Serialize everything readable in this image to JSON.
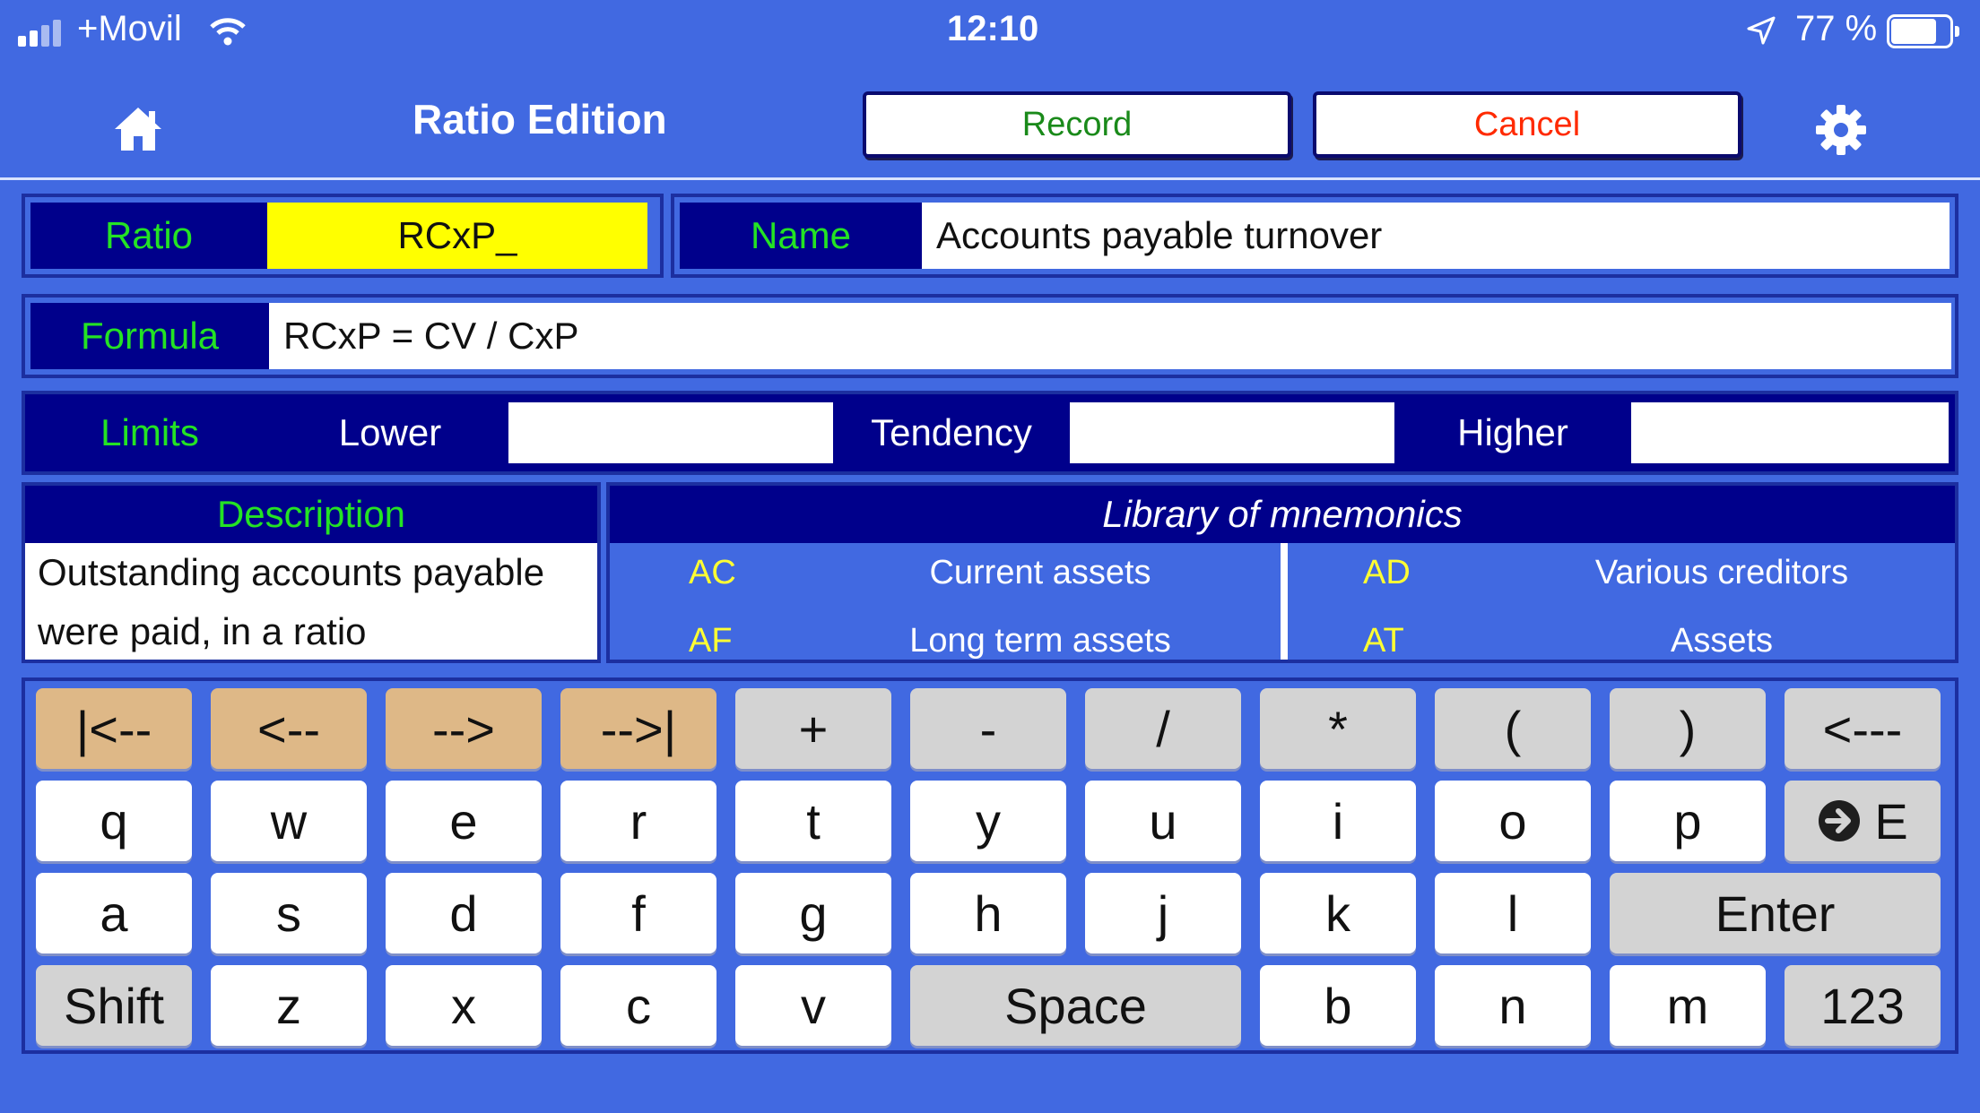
{
  "status_bar": {
    "carrier": "+Movil",
    "time": "12:10",
    "battery": "77 %",
    "battery_level": 0.77
  },
  "header": {
    "title": "Ratio Edition",
    "record_label": "Record",
    "cancel_label": "Cancel"
  },
  "form": {
    "ratio_label": "Ratio",
    "ratio_value": "RCxP_",
    "name_label": "Name",
    "name_value": "Accounts payable turnover",
    "formula_label": "Formula",
    "formula_value": "RCxP = CV / CxP",
    "limits_label": "Limits",
    "lower_label": "Lower",
    "lower_value": "",
    "tendency_label": "Tendency",
    "tendency_value": "",
    "higher_label": "Higher",
    "higher_value": "",
    "description_label": "Description",
    "description_value": "Outstanding accounts payable were paid, in a ratio"
  },
  "library": {
    "title": "Library of mnemonics",
    "items": [
      {
        "code": "AC",
        "desc": "Current assets"
      },
      {
        "code": "AD",
        "desc": "Various creditors"
      },
      {
        "code": "AF",
        "desc": "Long term assets"
      },
      {
        "code": "AT",
        "desc": "Assets"
      }
    ]
  },
  "keyboard": {
    "row1": [
      "|<--",
      "<--",
      "-->",
      "-->|",
      "+",
      "-",
      "/",
      "*",
      "(",
      ")",
      "<---"
    ],
    "row2": [
      "q",
      "w",
      "e",
      "r",
      "t",
      "y",
      "u",
      "i",
      "o",
      "p",
      "E"
    ],
    "row3": [
      "a",
      "s",
      "d",
      "f",
      "g",
      "h",
      "j",
      "k",
      "l",
      "Enter"
    ],
    "row4": [
      "Shift",
      "z",
      "x",
      "c",
      "v",
      "Space",
      "b",
      "n",
      "m",
      "123"
    ]
  },
  "colors": {
    "background": "#4169e1",
    "navy": "#00008b",
    "label_green": "#24e324",
    "ratio_highlight": "#ffff00",
    "record_text": "#1a8a1a",
    "cancel_text": "#ff2a00",
    "mnemonic_code": "#ffff33",
    "nav_key": "#deb887",
    "op_key": "#d3d3d3"
  },
  "icons": [
    "signal-icon",
    "wifi-icon",
    "location-arrow-icon",
    "battery-icon",
    "home-icon",
    "gear-icon",
    "arrow-circle-right-icon"
  ]
}
